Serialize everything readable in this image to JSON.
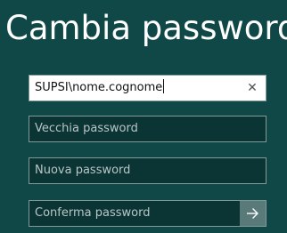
{
  "header": {
    "title": "Cambia password"
  },
  "form": {
    "username_value": "SUPSI\\nome.cognome",
    "clear_icon": "close-icon",
    "old_password_placeholder": "Vecchia password",
    "new_password_placeholder": "Nuova password",
    "confirm_password_placeholder": "Conferma password",
    "submit_icon": "arrow-right-icon"
  },
  "colors": {
    "background": "#0f4847",
    "field_background": "#0a3534",
    "field_border": "#7f9a99",
    "submit_button": "#5a7a79"
  }
}
